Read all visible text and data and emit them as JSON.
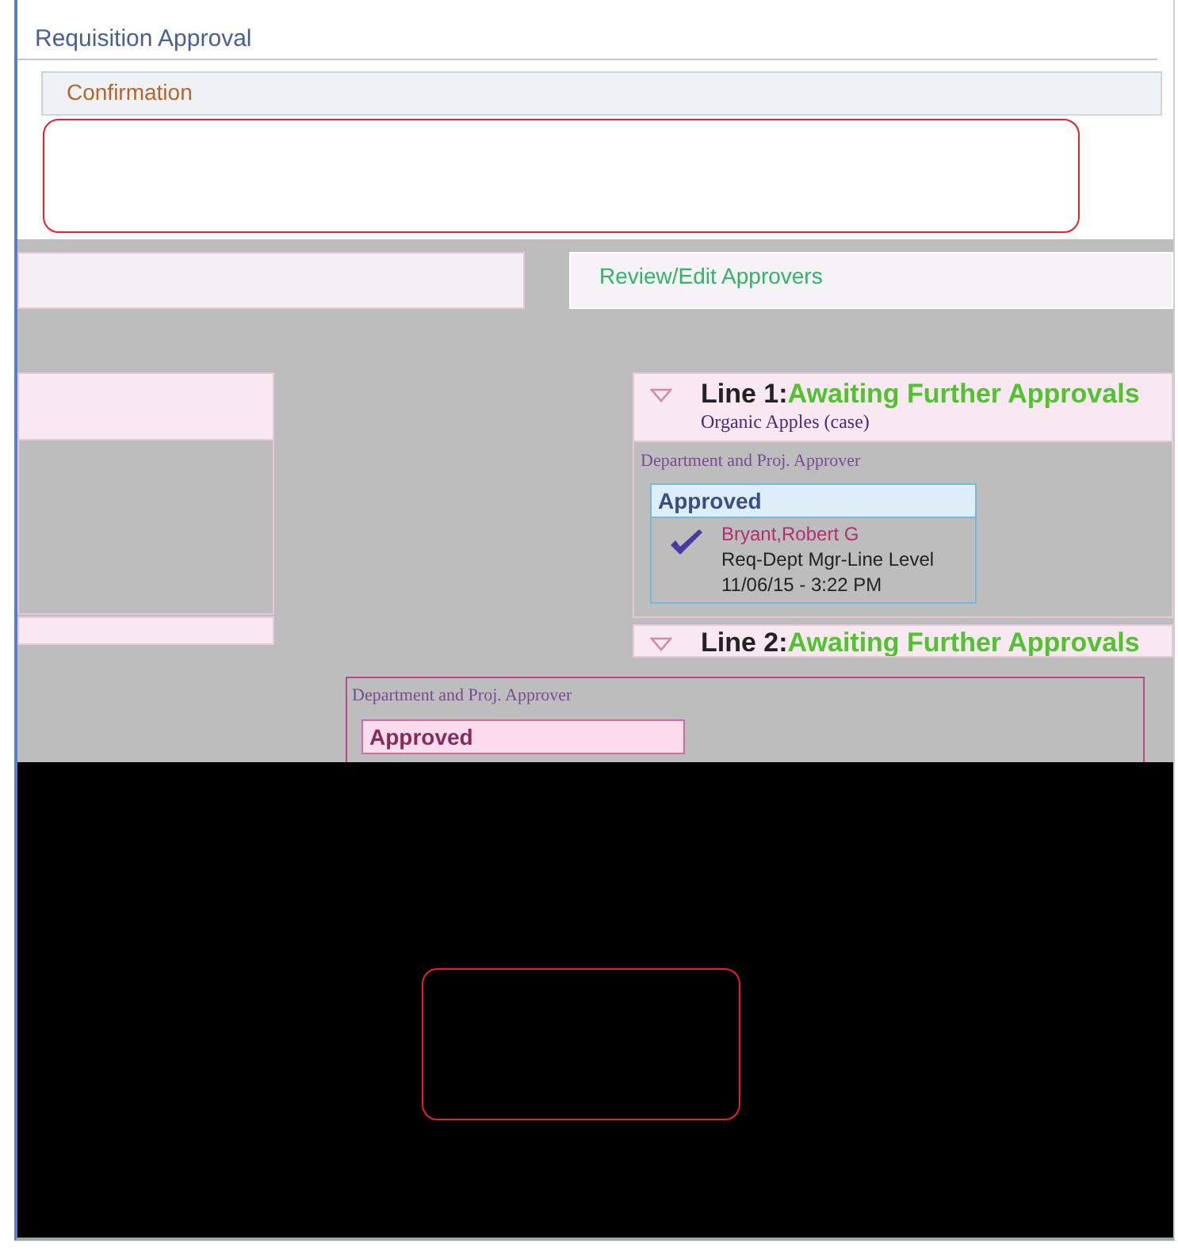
{
  "page_title": "Requisition Approval",
  "section_header": "Confirmation",
  "review_link": "Review/Edit Approvers",
  "lines": [
    {
      "line": "Line 1:",
      "status": "Awaiting Further Approvals",
      "expanded": true,
      "item": "Organic Apples (case)",
      "approver_group": "Department and Proj. Approver",
      "approval": {
        "status": "Approved",
        "name": "Bryant,Robert G",
        "role": "Req-Dept Mgr-Line Level",
        "date": "11/06/15 - 3:22 PM"
      }
    },
    {
      "line": "Line 2:",
      "status": "Awaiting Further Approvals",
      "expanded": true
    }
  ],
  "lower_panel": {
    "approver_group": "Department and Proj. Approver",
    "status": "Approved"
  }
}
